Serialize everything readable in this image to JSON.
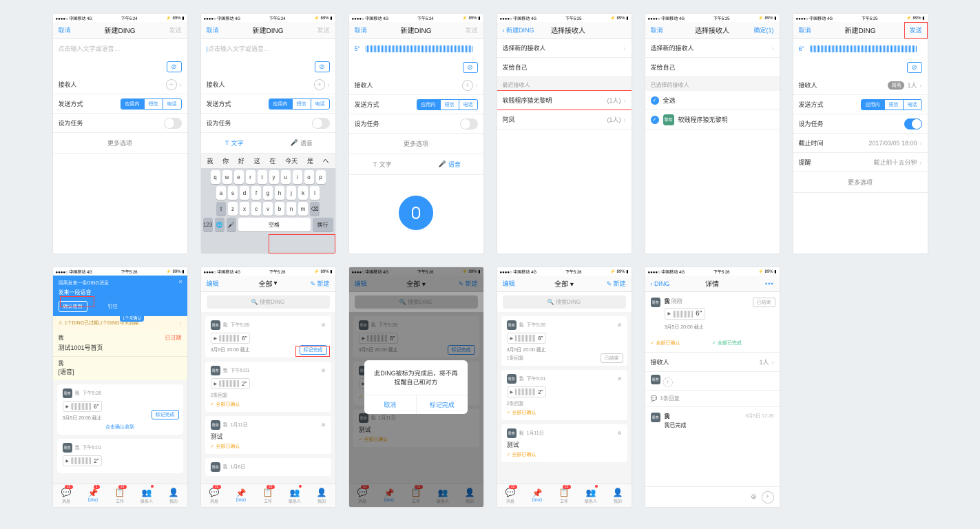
{
  "status": {
    "carrier": "中国移动",
    "net": "4G",
    "time524": "下午5:24",
    "time525": "下午5:25",
    "time526": "下午5:26",
    "battery": "89%"
  },
  "nav": {
    "cancel": "取消",
    "send": "发送",
    "new_ding": "新建DING",
    "back_ding": "新建DING",
    "select_recipient": "选择接收人",
    "confirm1": "确定(1)",
    "back_ding2": "DING",
    "detail": "详情"
  },
  "compose": {
    "placeholder": "点击输入文字或语音…",
    "recipient": "接收人",
    "method": "发送方式",
    "seg": {
      "app": "应用内",
      "sms": "短信",
      "phone": "电话"
    },
    "task": "设为任务",
    "deadline": "截止时间",
    "deadline_v": "2017/03/05 18:00",
    "remind": "提醒",
    "remind_v": "截止前十五分钟",
    "more": "更多选项",
    "text": "文字",
    "voice": "语音",
    "duration5": "5\"",
    "duration6": "6\"",
    "count1": "1人"
  },
  "keyboard": {
    "sugg": [
      "我",
      "你",
      "好",
      "这",
      "在",
      "今天",
      "是",
      "ヘ"
    ],
    "r1": [
      "q",
      "w",
      "e",
      "r",
      "t",
      "y",
      "u",
      "i",
      "o",
      "p"
    ],
    "r2": [
      "a",
      "s",
      "d",
      "f",
      "g",
      "h",
      "j",
      "k",
      "l"
    ],
    "r3": [
      "z",
      "x",
      "c",
      "v",
      "b",
      "n",
      "m"
    ],
    "num": "123",
    "space": "空格",
    "ret": "换行"
  },
  "recip": {
    "new": "选择新的接收人",
    "self": "发给自己",
    "recent": "最近接收人",
    "selected": "已选择的接收人",
    "p1": {
      "name": "软贱程序猿无黎明",
      "count": "(1人)"
    },
    "p2": {
      "name": "阿凤",
      "count": "(1人)"
    },
    "all": "全选"
  },
  "list": {
    "edit": "编辑",
    "all": "全部",
    "new": "新建",
    "search": "搜索DING",
    "banner_t": "周燕发来一条DING消息",
    "banner_s": "发来一段语音",
    "confirm": "确认收到",
    "pin": "钉住",
    "unread": "1个未确认",
    "warn": "1个DING已过期,1个DING今天到期",
    "me": "我",
    "expired": "已过期",
    "page": "测试1001号首页",
    "voice": "[语音]",
    "t526": "下午5:26",
    "t501": "下午5:01",
    "t0111": "1月11日",
    "t0106": "1月6日",
    "date": "3月5日 20:00",
    "deadline_l": "截止",
    "len6": "6\"",
    "len2": "2\"",
    "mark_done": "标记完成",
    "click_confirm": "点击确认收到",
    "ended": "已结束",
    "reply1": "1条回复",
    "reply2": "2条回复",
    "all_confirm": "全部已确认",
    "all_done": "全部已完成",
    "test": "测试"
  },
  "modal": {
    "msg": "此DING被标为完成后，将不再提醒自己和对方",
    "cancel": "取消",
    "ok": "标记完成"
  },
  "detail": {
    "sender": "周燕",
    "just": "刚刚",
    "len": "6\"",
    "due": "3月5日 20:00",
    "due_l": "截止",
    "recipient": "接收人",
    "count": "1人",
    "replies": "1条回复",
    "done_t": "3月5日 17:26",
    "done": "我已完成"
  },
  "tabs": {
    "msg": "消息",
    "ding": "DING",
    "work": "工作",
    "contact": "联系人",
    "me": "我的",
    "b22": "22",
    "b1": "1"
  }
}
